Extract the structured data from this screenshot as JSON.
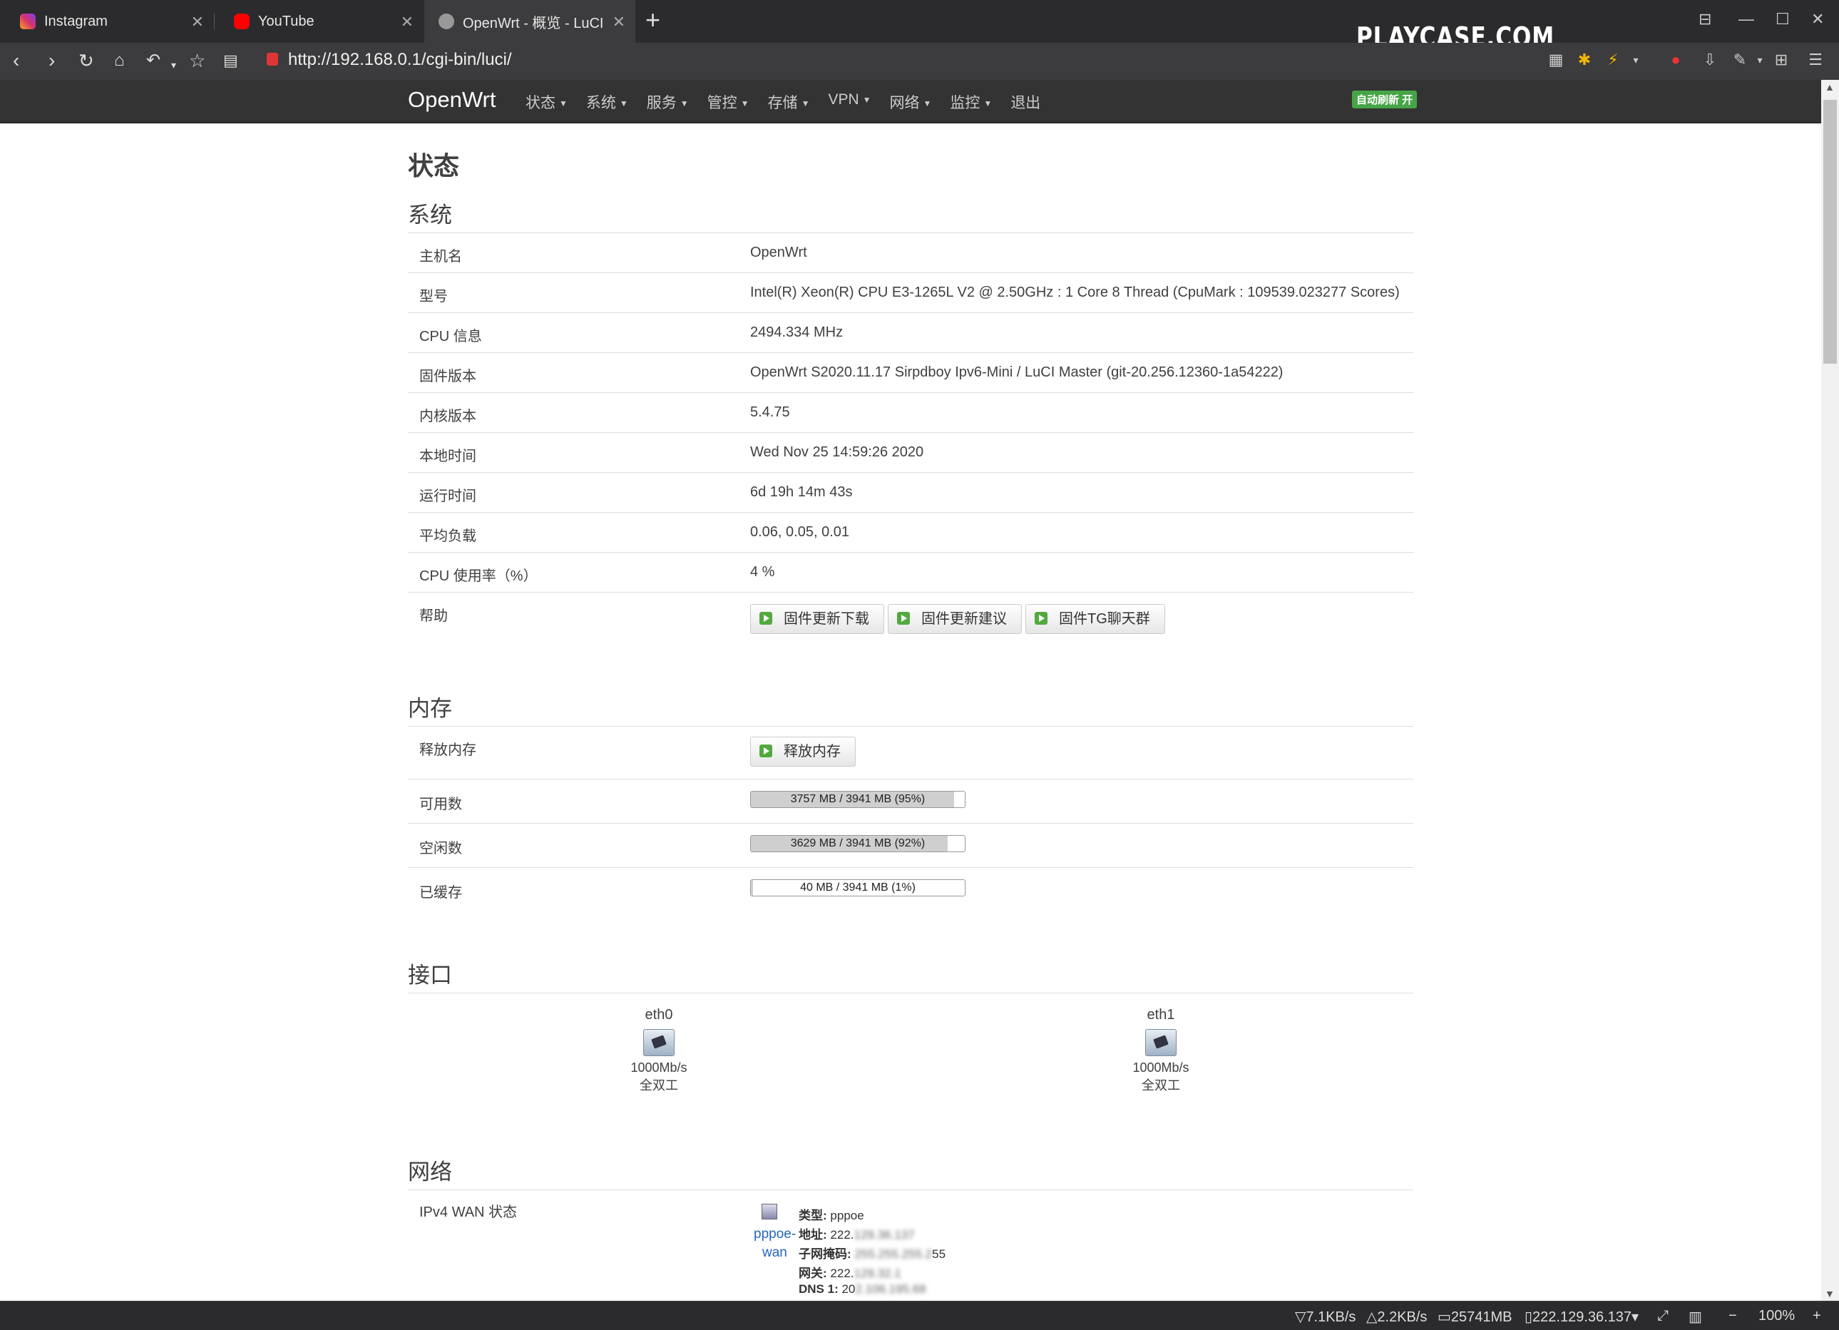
{
  "browser": {
    "tabs": [
      {
        "title": "Instagram",
        "icon": "instagram-icon",
        "color": "#d6336c"
      },
      {
        "title": "YouTube",
        "icon": "youtube-icon",
        "color": "#ff0000"
      },
      {
        "title": "OpenWrt - 概览 - LuCI",
        "icon": "openwrt-favicon",
        "color": "#888888",
        "active": true
      }
    ],
    "url": "http://192.168.0.1/cgi-bin/luci/",
    "overlay_text": "PLAYCASE.COM"
  },
  "header": {
    "brand": "OpenWrt",
    "menu": [
      "状态",
      "系统",
      "服务",
      "管控",
      "存储",
      "VPN",
      "网络",
      "监控",
      "退出"
    ],
    "badge": "自动刷新 开",
    "badge_color": "#46a546"
  },
  "page": {
    "title": "状态",
    "system": {
      "title": "系统",
      "rows": [
        {
          "label": "主机名",
          "value": "OpenWrt"
        },
        {
          "label": "型号",
          "value": "Intel(R) Xeon(R) CPU E3-1265L V2 @ 2.50GHz : 1 Core 8 Thread (CpuMark : 109539.023277 Scores)"
        },
        {
          "label": "CPU 信息",
          "value": "2494.334 MHz"
        },
        {
          "label": "固件版本",
          "value": "OpenWrt S2020.11.17 Sirpdboy Ipv6-Mini / LuCI Master (git-20.256.12360-1a54222)"
        },
        {
          "label": "内核版本",
          "value": "5.4.75"
        },
        {
          "label": "本地时间",
          "value": "Wed Nov 25 14:59:26 2020"
        },
        {
          "label": "运行时间",
          "value": "6d 19h 14m 43s"
        },
        {
          "label": "平均负载",
          "value": "0.06, 0.05, 0.01"
        },
        {
          "label": "CPU 使用率（%）",
          "value": "4 %"
        }
      ],
      "help_label": "帮助",
      "help_buttons": [
        "固件更新下载",
        "固件更新建议",
        "固件TG聊天群"
      ]
    },
    "memory": {
      "title": "内存",
      "release_label": "释放内存",
      "release_button": "释放内存",
      "rows": [
        {
          "label": "可用数",
          "text": "3757 MB / 3941 MB (95%)",
          "percent": 95
        },
        {
          "label": "空闲数",
          "text": "3629 MB / 3941 MB (92%)",
          "percent": 92
        },
        {
          "label": "已缓存",
          "text": "40 MB / 3941 MB (1%)",
          "percent": 1
        }
      ]
    },
    "interfaces": {
      "title": "接口",
      "items": [
        {
          "name": "eth0",
          "speed": "1000Mb/s",
          "duplex": "全双工"
        },
        {
          "name": "eth1",
          "speed": "1000Mb/s",
          "duplex": "全双工"
        }
      ]
    },
    "network": {
      "title": "网络",
      "wan_label": "IPv4 WAN 状态",
      "wan_name_1": "pppoe-",
      "wan_name_2": "wan",
      "lines": [
        {
          "key": "类型:",
          "value": "pppoe",
          "blurred": ""
        },
        {
          "key": "地址:",
          "value": "222.",
          "blurred": "129.36.137"
        },
        {
          "key": "子网掩码:",
          "value": "",
          "blurred": "255.255.255.2",
          "tail": "55"
        },
        {
          "key": "网关:",
          "value": "222.",
          "blurred": "129.32.1"
        },
        {
          "key": "DNS 1:",
          "value": "20",
          "blurred": "2.106.195.68"
        }
      ]
    }
  },
  "statusbar": {
    "down": "7.1KB/s",
    "up": "2.2KB/s",
    "mem": "25741MB",
    "ip": "222.129.36.137",
    "zoom": "100%"
  }
}
